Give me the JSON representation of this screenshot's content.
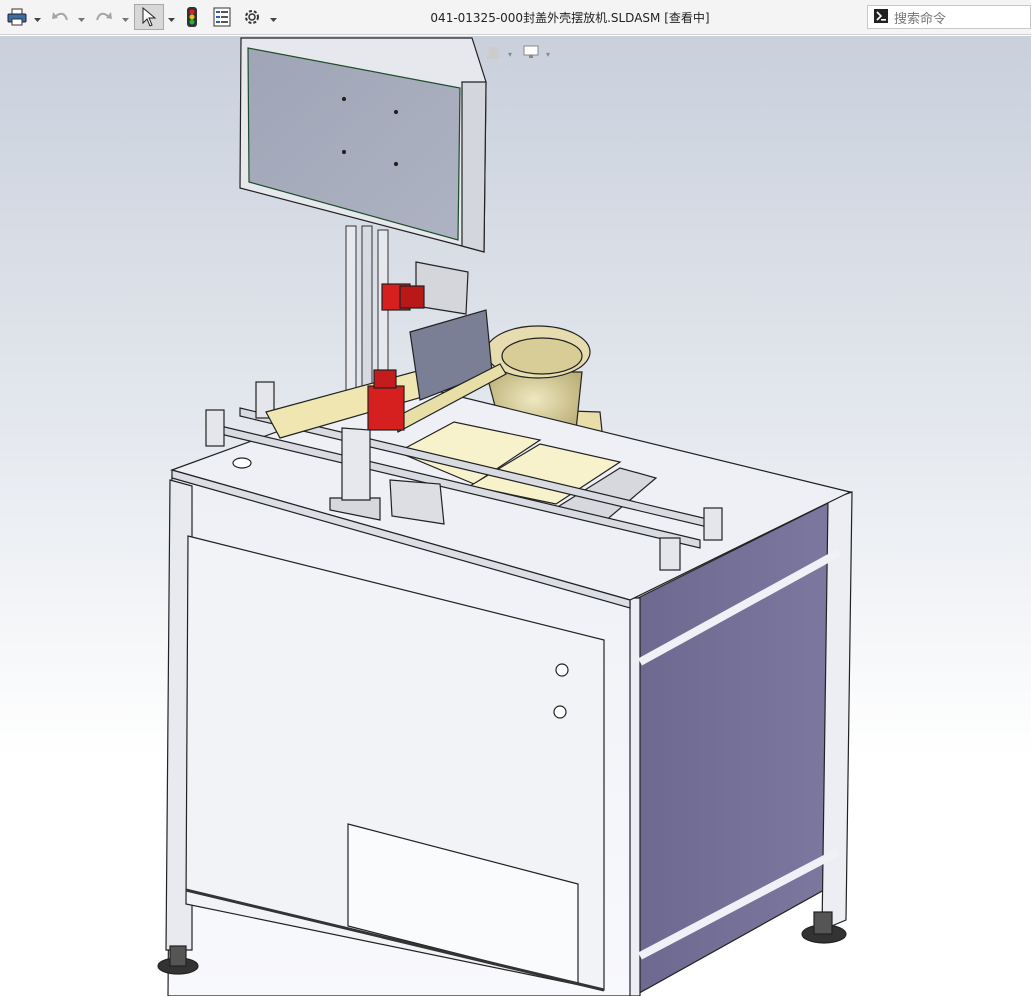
{
  "window": {
    "title": "041-01325-000封盖外壳摆放机.SLDASM [查看中]"
  },
  "toolbar": {
    "items": [
      {
        "name": "print-icon"
      },
      {
        "name": "undo-icon"
      },
      {
        "name": "redo-icon"
      },
      {
        "name": "select-pointer-icon",
        "selected": true
      },
      {
        "name": "rebuild-traffic-light-icon"
      },
      {
        "name": "file-properties-icon"
      },
      {
        "name": "options-gear-icon"
      }
    ]
  },
  "search": {
    "placeholder": "搜索命令"
  },
  "heads_up_toolbar": {
    "items": [
      {
        "name": "zoom-to-fit-icon"
      },
      {
        "name": "zoom-to-area-icon"
      },
      {
        "name": "previous-view-icon"
      },
      {
        "name": "section-view-icon"
      },
      {
        "name": "dynamic-annotation-icon"
      },
      {
        "name": "view-orientation-icon"
      },
      {
        "name": "display-style-icon"
      },
      {
        "name": "hide-show-items-icon"
      },
      {
        "name": "edit-appearance-icon"
      },
      {
        "name": "apply-scene-icon"
      },
      {
        "name": "view-settings-icon"
      }
    ]
  },
  "colors": {
    "frame": "#e8eaf2",
    "side_panel": "#6e6a8c",
    "motor_red": "#d62020",
    "feeder_bowl": "#d9d2a2",
    "plate": "#f5f0c8"
  }
}
